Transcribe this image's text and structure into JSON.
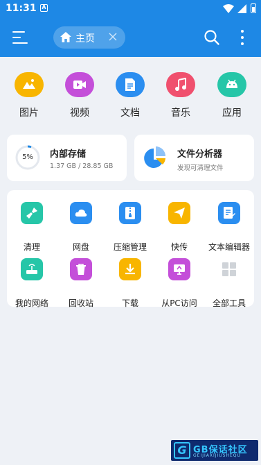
{
  "status_bar": {
    "time": "11:31",
    "notification_glyph": "A"
  },
  "app_bar": {
    "tab_label": "主页"
  },
  "categories": [
    {
      "label": "图片",
      "icon": "image-icon",
      "color": "#f8b500"
    },
    {
      "label": "视频",
      "icon": "video-icon",
      "color": "#c44fd9"
    },
    {
      "label": "文档",
      "icon": "document-icon",
      "color": "#2b8ef0"
    },
    {
      "label": "音乐",
      "icon": "music-icon",
      "color": "#f0506e"
    },
    {
      "label": "应用",
      "icon": "android-icon",
      "color": "#26c6a8"
    }
  ],
  "storage": {
    "percent": "5%",
    "title": "内部存储",
    "usage": "1.37 GB / 28.85 GB"
  },
  "analyzer": {
    "title": "文件分析器",
    "subtitle": "发现可清理文件"
  },
  "tools": [
    {
      "label": "清理",
      "icon": "broom-icon",
      "color": "#26c6a8"
    },
    {
      "label": "网盘",
      "icon": "cloud-icon",
      "color": "#2b8ef0"
    },
    {
      "label": "压缩管理",
      "icon": "zip-icon",
      "color": "#2b8ef0"
    },
    {
      "label": "快传",
      "icon": "send-icon",
      "color": "#f8b500"
    },
    {
      "label": "文本编辑器",
      "icon": "text-editor-icon",
      "color": "#2b8ef0"
    },
    {
      "label": "我的网络",
      "icon": "router-icon",
      "color": "#26c6a8"
    },
    {
      "label": "回收站",
      "icon": "trash-icon",
      "color": "#c44fd9"
    },
    {
      "label": "下载",
      "icon": "download-icon",
      "color": "#f8b500"
    },
    {
      "label": "从PC访问",
      "icon": "pc-access-icon",
      "color": "#c44fd9"
    },
    {
      "label": "全部工具",
      "icon": "grid-icon",
      "color": "#cfd3d8"
    }
  ],
  "watermark": {
    "text": "GB保话社区",
    "subtext": "GEIJIAXIJIUSHEQU"
  }
}
